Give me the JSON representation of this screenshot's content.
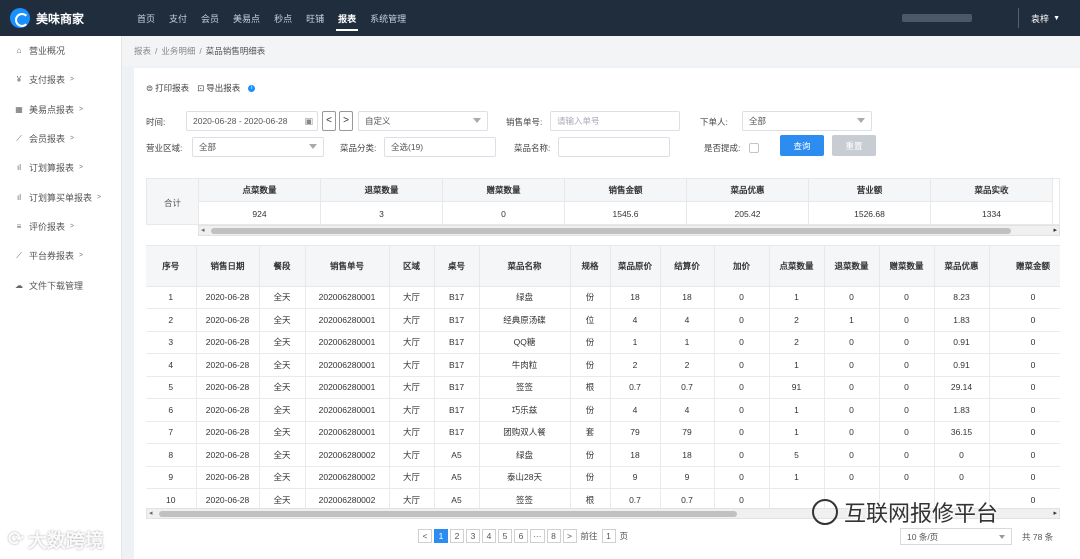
{
  "app": {
    "title": "美味商家"
  },
  "topnav": {
    "items": [
      "首页",
      "支付",
      "会员",
      "美易点",
      "秒点",
      "旺铺",
      "报表",
      "系统管理"
    ],
    "active_index": 6
  },
  "user": {
    "name": "袁梓",
    "caret": "▼"
  },
  "sidebar": {
    "items": [
      {
        "label": "营业概况",
        "icon": "home-icon",
        "glyph": "⌂",
        "arrow": ""
      },
      {
        "label": "支付报表",
        "icon": "yen-icon",
        "glyph": "¥",
        "arrow": ">"
      },
      {
        "label": "美易点报表",
        "icon": "grid-icon",
        "glyph": "▦",
        "arrow": ">"
      },
      {
        "label": "会员报表",
        "icon": "line-chart-icon",
        "glyph": "⟋",
        "arrow": ">"
      },
      {
        "label": "订划算报表",
        "icon": "bar-chart-icon",
        "glyph": "ıl",
        "arrow": ">"
      },
      {
        "label": "订划算买单报表",
        "icon": "bar-chart-icon",
        "glyph": "ıl",
        "arrow": ">"
      },
      {
        "label": "评价报表",
        "icon": "list-icon",
        "glyph": "≡",
        "arrow": ">"
      },
      {
        "label": "平台券报表",
        "icon": "line-chart-icon",
        "glyph": "⟋",
        "arrow": ">"
      },
      {
        "label": "文件下载管理",
        "icon": "cloud-icon",
        "glyph": "☁",
        "arrow": ""
      }
    ]
  },
  "breadcrumb": {
    "items": [
      "报表",
      "业务明细",
      "菜品销售明细表"
    ],
    "sep": "/"
  },
  "toolbar": {
    "print": "打印报表",
    "export": "导出报表",
    "info": "i"
  },
  "filters": {
    "time_label": "时间:",
    "time_value": "2020-06-28 - 2020-06-28",
    "prev": "<",
    "next": ">",
    "range_value": "自定义",
    "order_label": "销售单号:",
    "order_placeholder": "请输入单号",
    "orderer_label": "下单人:",
    "orderer_value": "全部",
    "area_label": "营业区域:",
    "area_value": "全部",
    "category_label": "菜品分类:",
    "category_value": "全选(19)",
    "dish_label": "菜品名称:",
    "dish_value": "",
    "mention_label": "是否提成:",
    "query": "查询",
    "reset": "重置"
  },
  "summary": {
    "row_label": "合计",
    "columns": [
      {
        "h": "点菜数量",
        "v": "924"
      },
      {
        "h": "退菜数量",
        "v": "3"
      },
      {
        "h": "赠菜数量",
        "v": "0"
      },
      {
        "h": "销售金额",
        "v": "1545.6"
      },
      {
        "h": "菜品优惠",
        "v": "205.42"
      },
      {
        "h": "营业额",
        "v": "1526.68"
      },
      {
        "h": "菜品实收",
        "v": "1334"
      }
    ],
    "scroll_left": "◂",
    "scroll_right": "▸"
  },
  "table": {
    "headers": [
      "序号",
      "销售日期",
      "餐段",
      "销售单号",
      "区域",
      "桌号",
      "菜品名称",
      "规格",
      "菜品原价",
      "结算价",
      "加价",
      "点菜数量",
      "退菜数量",
      "赠菜数量",
      "菜品优惠",
      "赠菜金额"
    ],
    "rows": [
      [
        "1",
        "2020-06-28",
        "全天",
        "202006280001",
        "大厅",
        "B17",
        "绿盘",
        "份",
        "18",
        "18",
        "0",
        "1",
        "0",
        "0",
        "8.23",
        "0"
      ],
      [
        "2",
        "2020-06-28",
        "全天",
        "202006280001",
        "大厅",
        "B17",
        "经典原汤碟",
        "位",
        "4",
        "4",
        "0",
        "2",
        "1",
        "0",
        "1.83",
        "0"
      ],
      [
        "3",
        "2020-06-28",
        "全天",
        "202006280001",
        "大厅",
        "B17",
        "QQ糖",
        "份",
        "1",
        "1",
        "0",
        "2",
        "0",
        "0",
        "0.91",
        "0"
      ],
      [
        "4",
        "2020-06-28",
        "全天",
        "202006280001",
        "大厅",
        "B17",
        "牛肉粒",
        "份",
        "2",
        "2",
        "0",
        "1",
        "0",
        "0",
        "0.91",
        "0"
      ],
      [
        "5",
        "2020-06-28",
        "全天",
        "202006280001",
        "大厅",
        "B17",
        "签签",
        "根",
        "0.7",
        "0.7",
        "0",
        "91",
        "0",
        "0",
        "29.14",
        "0"
      ],
      [
        "6",
        "2020-06-28",
        "全天",
        "202006280001",
        "大厅",
        "B17",
        "巧乐兹",
        "份",
        "4",
        "4",
        "0",
        "1",
        "0",
        "0",
        "1.83",
        "0"
      ],
      [
        "7",
        "2020-06-28",
        "全天",
        "202006280001",
        "大厅",
        "B17",
        "团购双人餐",
        "套",
        "79",
        "79",
        "0",
        "1",
        "0",
        "0",
        "36.15",
        "0"
      ],
      [
        "8",
        "2020-06-28",
        "全天",
        "202006280002",
        "大厅",
        "A5",
        "绿盘",
        "份",
        "18",
        "18",
        "0",
        "5",
        "0",
        "0",
        "0",
        "0"
      ],
      [
        "9",
        "2020-06-28",
        "全天",
        "202006280002",
        "大厅",
        "A5",
        "泰山28天",
        "份",
        "9",
        "9",
        "0",
        "1",
        "0",
        "0",
        "0",
        "0"
      ],
      [
        "10",
        "2020-06-28",
        "全天",
        "202006280002",
        "大厅",
        "A5",
        "签签",
        "根",
        "0.7",
        "0.7",
        "0",
        "",
        "",
        "",
        "",
        "0"
      ]
    ]
  },
  "pagination": {
    "prev": "<",
    "pages": [
      "1",
      "2",
      "3",
      "4",
      "5",
      "6",
      "···",
      "8"
    ],
    "active": "1",
    "next": ">",
    "goto_label": "前往",
    "goto_value": "1",
    "page_unit": "页",
    "page_size": "10 条/页",
    "total": "共 78 条"
  },
  "watermarks": {
    "left": "大数跨境",
    "right": "互联网报修平台"
  },
  "colors": {
    "topbar": "#1f2d3d",
    "accent": "#2d8cf0",
    "sidebar_bg": "#ffffff",
    "page_bg": "#eef1f6"
  }
}
